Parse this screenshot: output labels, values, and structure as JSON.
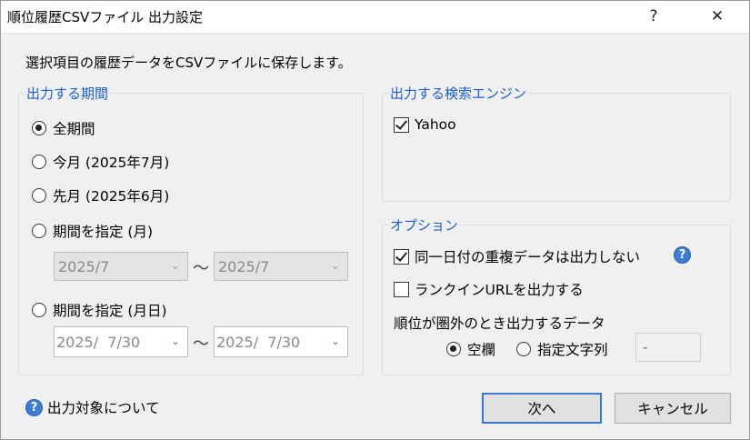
{
  "window": {
    "title": "順位履歴CSVファイル 出力設定",
    "help_button": "?",
    "close_button": "✕"
  },
  "description": "選択項目の履歴データをCSVファイルに保存します。",
  "period": {
    "legend": "出力する期間",
    "options": [
      {
        "label": "全期間",
        "checked": true
      },
      {
        "label": "今月 (2025年7月)",
        "checked": false
      },
      {
        "label": "先月 (2025年6月)",
        "checked": false
      },
      {
        "label": "期間を指定 (月)",
        "checked": false
      },
      {
        "label": "期間を指定 (月日)",
        "checked": false
      }
    ],
    "month_range": {
      "from": "2025/7",
      "to": "2025/7"
    },
    "date_range": {
      "from": "2025/  7/30",
      "to": "2025/  7/30"
    },
    "range_separator": "～"
  },
  "engines": {
    "legend": "出力する検索エンジン",
    "items": [
      {
        "label": "Yahoo",
        "checked": true
      }
    ]
  },
  "options": {
    "legend": "オプション",
    "no_duplicates": {
      "label": "同一日付の重複データは出力しない",
      "checked": true
    },
    "rank_in_url": {
      "label": "ランクインURLを出力する",
      "checked": false
    },
    "out_of_rank_label": "順位が圏外のとき出力するデータ",
    "out_of_rank_choices": [
      {
        "label": "空欄",
        "checked": true
      },
      {
        "label": "指定文字列",
        "checked": false
      }
    ],
    "custom_string": "-",
    "help_glyph": "?"
  },
  "footer": {
    "help_link": "出力対象について",
    "next_button": "次へ",
    "cancel_button": "キャンセル"
  },
  "colors": {
    "accent": "#1b5fcf",
    "focus_border": "#3b7ad0"
  }
}
